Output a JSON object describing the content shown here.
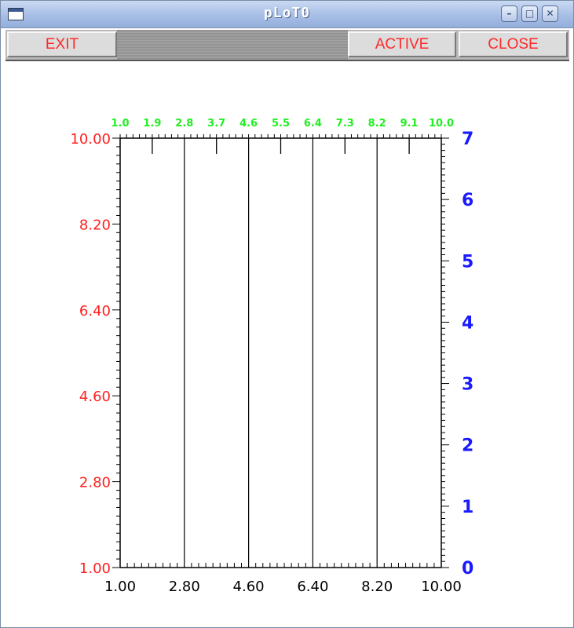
{
  "window": {
    "title": "pLoT0"
  },
  "toolbar": {
    "exit_label": "EXIT",
    "active_label": "ACTIVE",
    "close_label": "CLOSE"
  },
  "window_controls": [
    "minimize-icon",
    "maximize-icon",
    "close-icon"
  ],
  "colors": {
    "left_axis": "#ff2020",
    "right_axis": "#1a1aff",
    "top_axis": "#22ee22",
    "bottom_axis": "#000000",
    "gridline": "#000000"
  },
  "chart_data": {
    "type": "line",
    "title": "",
    "xlim": [
      1.0,
      10.0
    ],
    "ylim": [
      1.0,
      10.0
    ],
    "y2lim": [
      0,
      7
    ],
    "bottom_ticks": [
      "1.00",
      "2.80",
      "4.60",
      "6.40",
      "8.20",
      "10.00"
    ],
    "top_ticks": [
      "1.0",
      "1.9",
      "2.8",
      "3.7",
      "4.6",
      "5.5",
      "6.4",
      "7.3",
      "8.2",
      "9.1",
      "10.0"
    ],
    "left_ticks": [
      "1.00",
      "2.80",
      "4.60",
      "6.40",
      "8.20",
      "10.00"
    ],
    "right_ticks": [
      "0",
      "1",
      "2",
      "3",
      "4",
      "5",
      "6",
      "7"
    ],
    "vertical_gridlines_x": [
      2.8,
      4.6,
      6.4,
      8.2
    ],
    "series": []
  }
}
